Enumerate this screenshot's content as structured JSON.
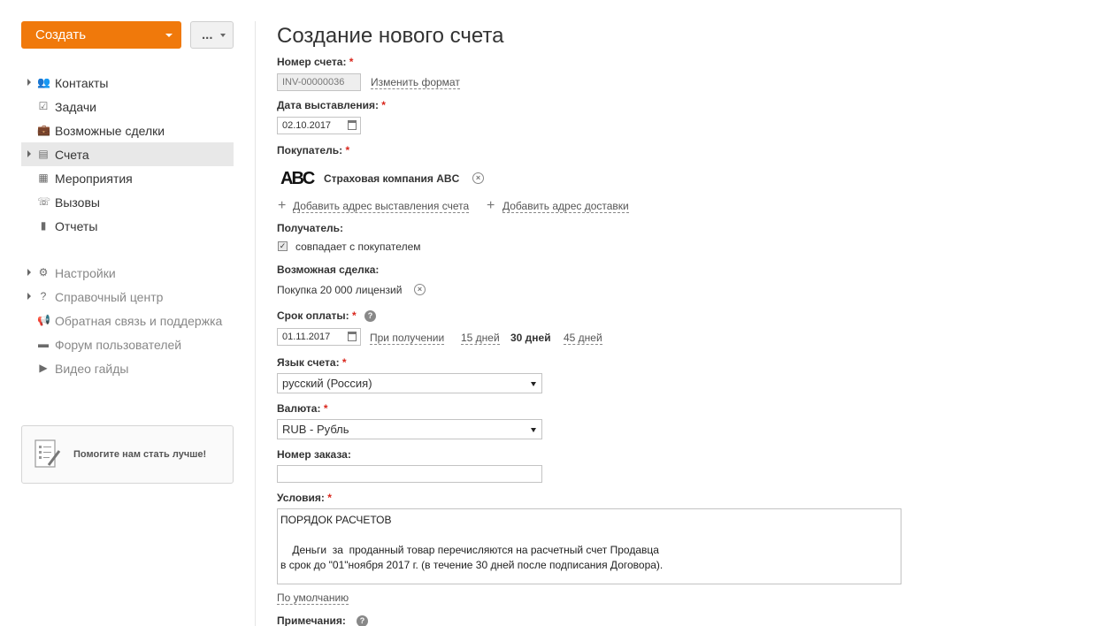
{
  "sidebar": {
    "create_label": "Создать",
    "more_label": "...",
    "nav": [
      {
        "label": "Контакты",
        "icon": "contacts-icon",
        "glyph": "👥",
        "has_caret": true,
        "active": false
      },
      {
        "label": "Задачи",
        "icon": "tasks-icon",
        "glyph": "☑",
        "has_caret": false,
        "active": false
      },
      {
        "label": "Возможные сделки",
        "icon": "deals-icon",
        "glyph": "💼",
        "has_caret": false,
        "active": false
      },
      {
        "label": "Счета",
        "icon": "invoices-icon",
        "glyph": "▤",
        "has_caret": true,
        "active": true
      },
      {
        "label": "Мероприятия",
        "icon": "calendar-icon",
        "glyph": "▦",
        "has_caret": false,
        "active": false
      },
      {
        "label": "Вызовы",
        "icon": "phone-icon",
        "glyph": "☏",
        "has_caret": false,
        "active": false
      },
      {
        "label": "Отчеты",
        "icon": "reports-icon",
        "glyph": "▮",
        "has_caret": false,
        "active": false
      }
    ],
    "secondary": [
      {
        "label": "Настройки",
        "icon": "gear-icon",
        "glyph": "⚙",
        "has_caret": true
      },
      {
        "label": "Справочный центр",
        "icon": "question-icon",
        "glyph": "?",
        "has_caret": true
      },
      {
        "label": "Обратная связь и поддержка",
        "icon": "megaphone-icon",
        "glyph": "📢",
        "has_caret": false
      },
      {
        "label": "Форум пользователей",
        "icon": "chat-icon",
        "glyph": "▬",
        "has_caret": false
      },
      {
        "label": "Видео гайды",
        "icon": "video-icon",
        "glyph": "▶",
        "has_caret": false
      }
    ],
    "help_label": "Помогите нам стать лучше!"
  },
  "form": {
    "title": "Создание нового счета",
    "invoice_number_label": "Номер счета:",
    "invoice_number_value": "INV-00000036",
    "change_format_link": "Изменить формат",
    "issue_date_label": "Дата выставления:",
    "issue_date_value": "02.10.2017",
    "buyer_label": "Покупатель:",
    "buyer_logo": "ABC",
    "buyer_name": "Страховая компания ABC",
    "add_billing_address": "Добавить адрес выставления счета",
    "add_delivery_address": "Добавить адрес доставки",
    "recipient_label": "Получатель:",
    "same_as_buyer_label": "совпадает с покупателем",
    "same_as_buyer_checked": true,
    "deal_label": "Возможная сделка:",
    "deal_value": "Покупка 20 000 лицензий",
    "due_label": "Срок оплаты:",
    "due_date_value": "01.11.2017",
    "due_options": [
      "При получении",
      "15 дней",
      "30 дней",
      "45 дней"
    ],
    "due_selected": "30 дней",
    "language_label": "Язык счета:",
    "language_value": "русский (Россия)",
    "currency_label": "Валюта:",
    "currency_value": "RUB - Рубль",
    "order_number_label": "Номер заказа:",
    "order_number_value": "",
    "terms_label": "Условия:",
    "terms_text": "ПОРЯДОК РАСЧЕТОВ\n\n    Деньги  за  проданный товар перечисляются на расчетный счет Продавца\nв срок до \"01\"ноября 2017 г. (в течение 30 дней после подписания Договора).",
    "default_link": "По умолчанию",
    "notes_label": "Примечания:"
  },
  "colors": {
    "accent": "#f0790b",
    "required": "#d9261c"
  }
}
